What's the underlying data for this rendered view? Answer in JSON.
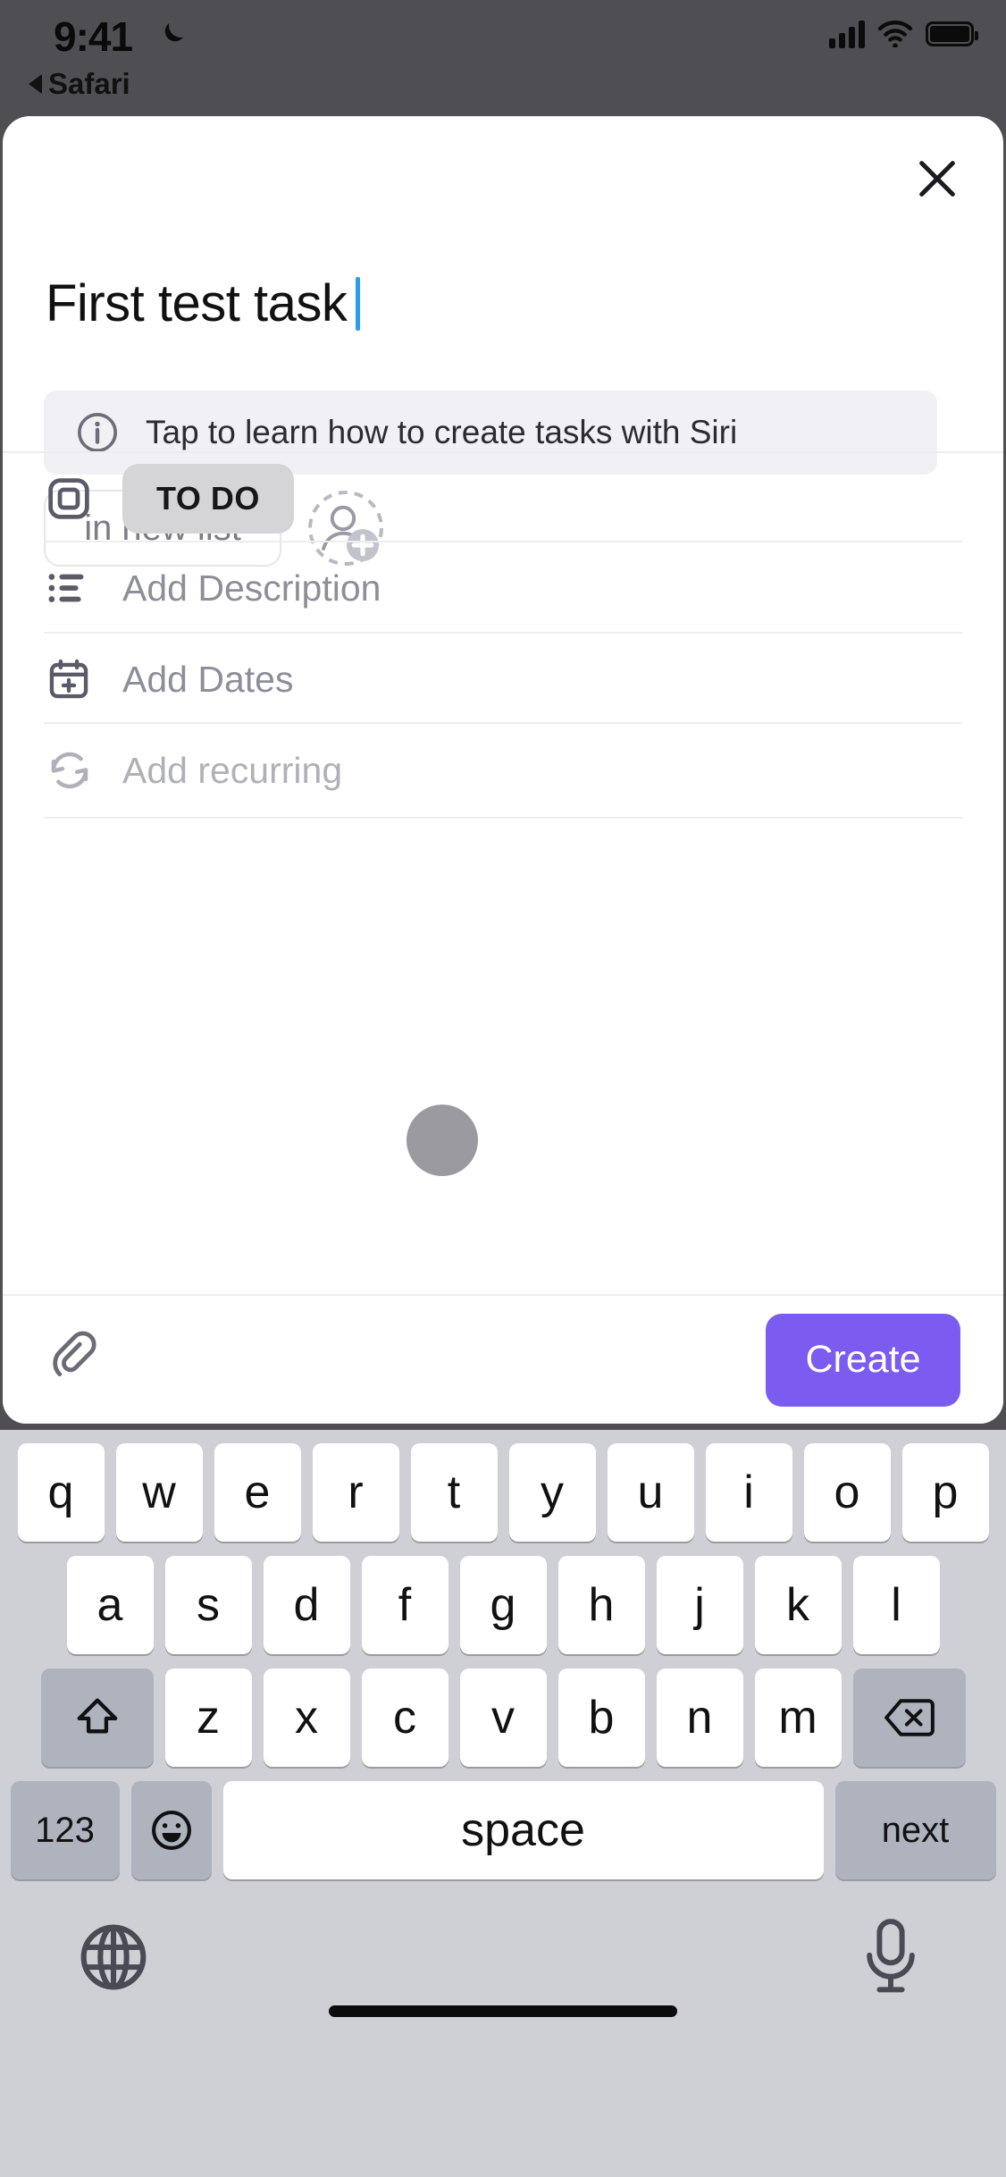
{
  "status_bar": {
    "time": "9:41",
    "dnd_icon": "moon-icon",
    "back_label": "Safari",
    "signal_icon": "cellular-signal-icon",
    "wifi_icon": "wifi-icon",
    "battery_icon": "battery-icon"
  },
  "sheet": {
    "close_icon": "close-icon",
    "task_title": "First test task",
    "siri_banner": {
      "icon": "info-circle-icon",
      "text": "Tap to learn how to create tasks with Siri"
    },
    "list_chip_label": "in new list",
    "assignee_icon": "add-person-icon",
    "rows": [
      {
        "icon": "status-square-icon",
        "label": "TO DO",
        "type": "pill"
      },
      {
        "icon": "description-list-icon",
        "label": "Add Description",
        "type": "text"
      },
      {
        "icon": "calendar-plus-icon",
        "label": "Add Dates",
        "type": "text"
      },
      {
        "icon": "recurring-arrows-icon",
        "label": "Add recurring",
        "type": "text-faint"
      }
    ],
    "bottom_bar": {
      "attach_icon": "paperclip-icon",
      "create_label": "Create",
      "create_color": "#7c5cf0"
    }
  },
  "keyboard": {
    "row1": [
      "q",
      "w",
      "e",
      "r",
      "t",
      "y",
      "u",
      "i",
      "o",
      "p"
    ],
    "row2": [
      "a",
      "s",
      "d",
      "f",
      "g",
      "h",
      "j",
      "k",
      "l"
    ],
    "row3": [
      "z",
      "x",
      "c",
      "v",
      "b",
      "n",
      "m"
    ],
    "shift_icon": "shift-up-arrow-icon",
    "backspace_icon": "backspace-icon",
    "numbers_label": "123",
    "emoji_icon": "emoji-smiley-icon",
    "space_label": "space",
    "return_label": "next",
    "globe_icon": "globe-icon",
    "mic_icon": "microphone-icon"
  }
}
